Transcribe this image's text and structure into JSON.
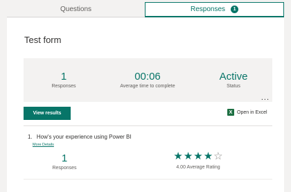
{
  "tabs": [
    {
      "label": "Questions",
      "active": false
    },
    {
      "label": "Responses",
      "active": true,
      "badge": "1"
    }
  ],
  "form": {
    "title": "Test form"
  },
  "summary": {
    "responses": {
      "value": "1",
      "label": "Responses"
    },
    "avg_time": {
      "value": "00:06",
      "label": "Average time to complete"
    },
    "status": {
      "value": "Active",
      "label": "Status"
    },
    "more_label": "..."
  },
  "actions": {
    "view_results": "View results",
    "open_in_excel": "Open in Excel",
    "excel_icon_glyph": "X"
  },
  "questions": [
    {
      "number": "1.",
      "text": "How's your experience using Power BI",
      "more_details": "More Details",
      "responses": {
        "value": "1",
        "label": "Responses"
      },
      "rating": {
        "filled_stars": 4,
        "total_stars": 5,
        "label": "4.00 Average Rating"
      }
    }
  ],
  "colors": {
    "accent": "#077568",
    "excel": "#1d6f42",
    "background": "#f3f2f1"
  }
}
